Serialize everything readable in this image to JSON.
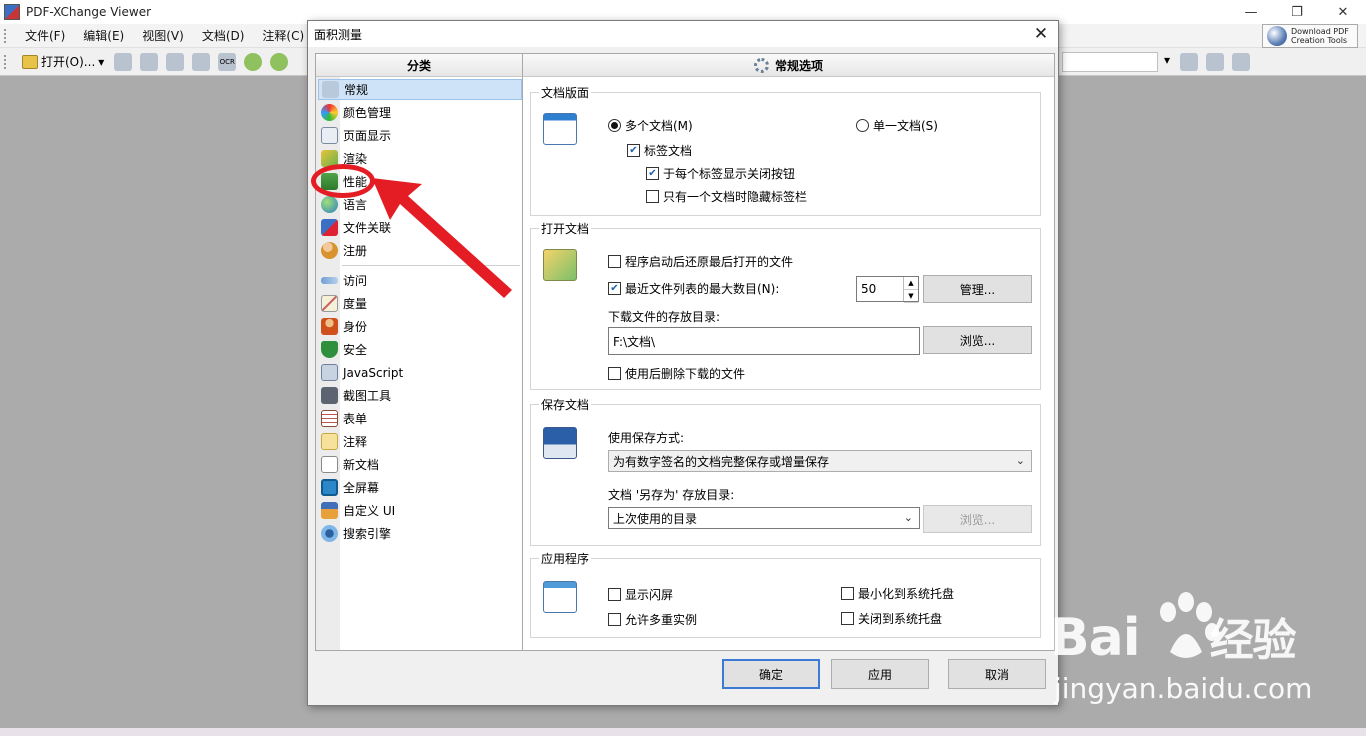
{
  "app": {
    "title": "PDF-XChange Viewer",
    "menus": [
      "文件(F)",
      "编辑(E)",
      "视图(V)",
      "文档(D)",
      "注释(C)"
    ],
    "download_line1": "Download PDF",
    "download_line2": "Creation Tools",
    "toolbar_open": "打开(O)...",
    "ocr_label": "OCR"
  },
  "dialog": {
    "title": "面积测量",
    "category_header": "分类",
    "options_header": "常规选项",
    "categories": [
      "常规",
      "颜色管理",
      "页面显示",
      "渲染",
      "性能",
      "语言",
      "文件关联",
      "注册",
      "访问",
      "度量",
      "身份",
      "安全",
      "JavaScript",
      "截图工具",
      "表单",
      "注释",
      "新文档",
      "全屏幕",
      "自定义 UI",
      "搜索引擎"
    ],
    "selected_category": "常规",
    "doc_layout": {
      "label": "文档版面",
      "radio_multi": "多个文档(M)",
      "radio_single": "单一文档(S)",
      "tabbed": "标签文档",
      "show_close_each_tab": "于每个标签显示关闭按钮",
      "hide_tabs_single": "只有一个文档时隐藏标签栏"
    },
    "open_docs": {
      "label": "打开文档",
      "restore_last": "程序启动后还原最后打开的文件",
      "max_recent": "最近文件列表的最大数目(N):",
      "max_recent_value": "50",
      "manage_button": "管理...",
      "download_dir_label": "下载文件的存放目录:",
      "download_dir_value": "F:\\文档\\",
      "browse_button": "浏览...",
      "delete_after_use": "使用后删除下载的文件"
    },
    "save_docs": {
      "label": "保存文档",
      "save_method_label": "使用保存方式:",
      "save_method_value": "为有数字签名的文档完整保存或增量保存",
      "save_as_label": "文档 '另存为' 存放目录:",
      "save_as_value": "上次使用的目录",
      "browse_button": "浏览..."
    },
    "application": {
      "label": "应用程序",
      "show_splash": "显示闪屏",
      "allow_multi": "允许多重实例",
      "min_to_tray": "最小化到系统托盘",
      "close_to_tray": "关闭到系统托盘"
    },
    "buttons": {
      "ok": "确定",
      "apply": "应用",
      "cancel": "取消"
    }
  },
  "watermark": {
    "logo_text": "Bai",
    "logo_text2": "经验",
    "url": "jingyan.baidu.com"
  },
  "colors": {
    "annotation": "#e41d24",
    "selection": "#cfe3f8",
    "default_button_border": "#3d7ad6"
  }
}
